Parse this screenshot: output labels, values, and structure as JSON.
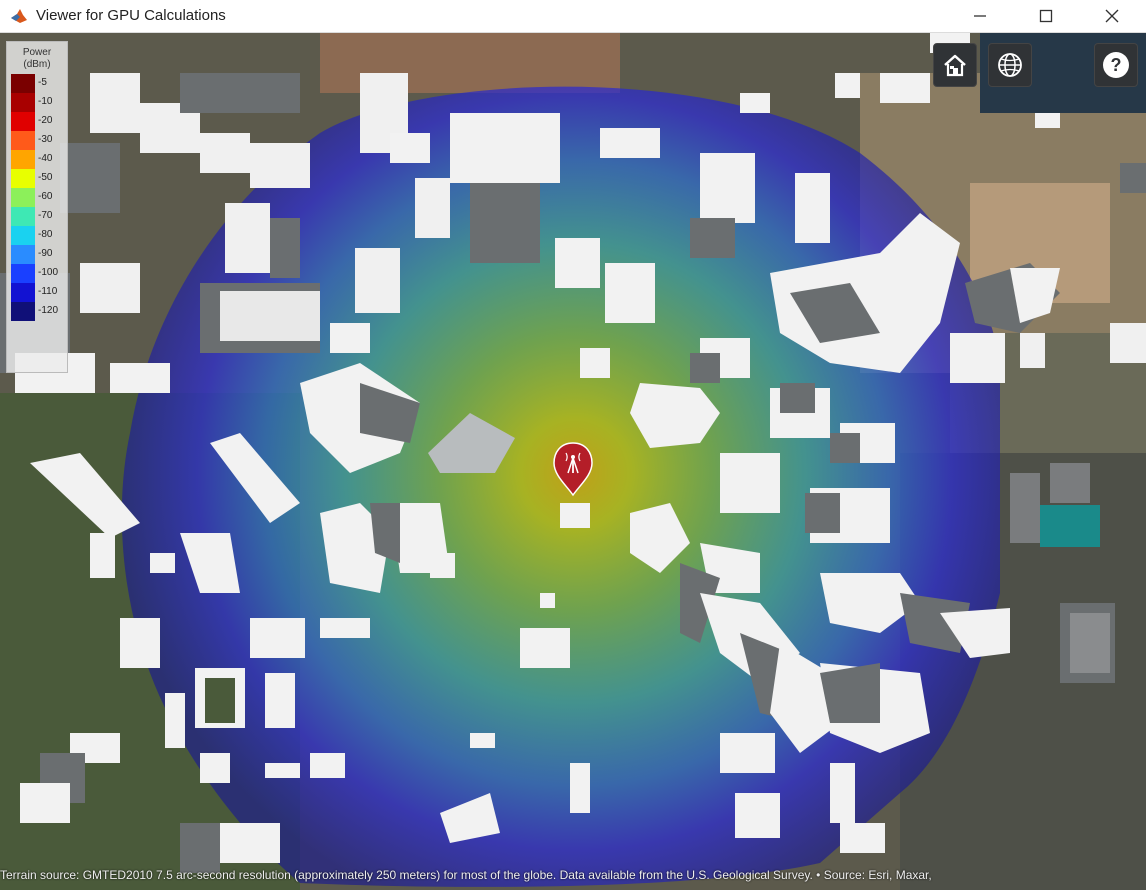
{
  "window": {
    "title": "Viewer for GPU Calculations",
    "minimize_icon": "minimize-icon",
    "maximize_icon": "maximize-icon",
    "close_icon": "close-icon"
  },
  "toolbar": {
    "home_icon": "home-icon",
    "globe_icon": "globe-icon",
    "help_icon": "help-icon",
    "help_label": "?"
  },
  "legend": {
    "title_line1": "Power",
    "title_line2": "(dBm)",
    "items": [
      {
        "label": "-5",
        "color": "#7a0000"
      },
      {
        "label": "-10",
        "color": "#a80000"
      },
      {
        "label": "-20",
        "color": "#e00000"
      },
      {
        "label": "-30",
        "color": "#ff5a1a"
      },
      {
        "label": "-40",
        "color": "#ffa500"
      },
      {
        "label": "-50",
        "color": "#e8ff00"
      },
      {
        "label": "-60",
        "color": "#8cf05a"
      },
      {
        "label": "-70",
        "color": "#3ee8b4"
      },
      {
        "label": "-80",
        "color": "#1ad2f0"
      },
      {
        "label": "-90",
        "color": "#2a8cff"
      },
      {
        "label": "-100",
        "color": "#1a40ff"
      },
      {
        "label": "-110",
        "color": "#1212d2"
      },
      {
        "label": "-120",
        "color": "#101078"
      }
    ]
  },
  "marker": {
    "icon": "transmitter-icon",
    "color": "#b41e28"
  },
  "attribution": "Terrain source: GMTED2010 7.5 arc-second resolution (approximately 250 meters) for most of the globe. Data available from the U.S. Geological Survey. • Source: Esri, Maxar,"
}
